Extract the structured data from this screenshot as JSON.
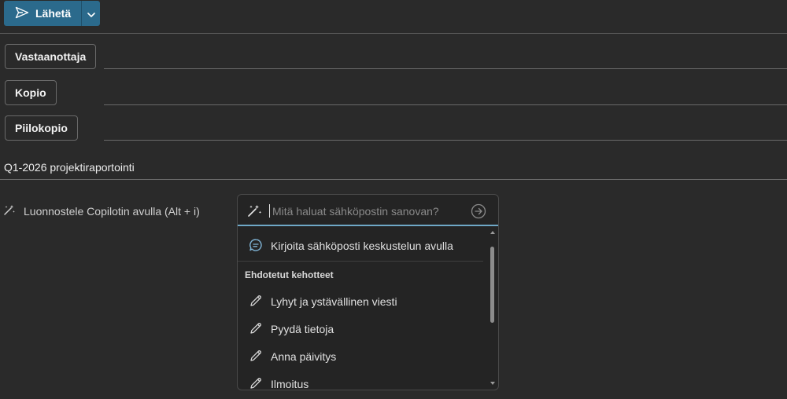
{
  "toolbar": {
    "send_label": "Lähetä"
  },
  "recipients": {
    "to_label": "Vastaanottaja",
    "cc_label": "Kopio",
    "bcc_label": "Piilokopio"
  },
  "subject": {
    "value": "Q1-2026 projektiraportointi"
  },
  "copilot": {
    "draft_label": "Luonnostele Copilotin avulla (Alt + i)",
    "prompt_placeholder": "Mitä haluat sähköpostin sanovan?",
    "chat_option": "Kirjoita sähköposti keskustelun avulla",
    "suggested_heading": "Ehdotetut kehotteet",
    "suggestions": [
      "Lyhyt ja ystävällinen viesti",
      "Pyydä tietoja",
      "Anna päivitys",
      "Ilmoitus"
    ]
  },
  "colors": {
    "send_button": "#2b6a8c",
    "background": "#2a2a2a",
    "prompt_focus": "#6fa8c7"
  },
  "icons": {
    "send": "send-icon",
    "dropdown": "chevron-down-icon",
    "copilot": "copilot-wand-icon",
    "submit": "arrow-right-circle-icon",
    "chat": "chat-bubble-icon",
    "pencil": "pencil-icon"
  }
}
